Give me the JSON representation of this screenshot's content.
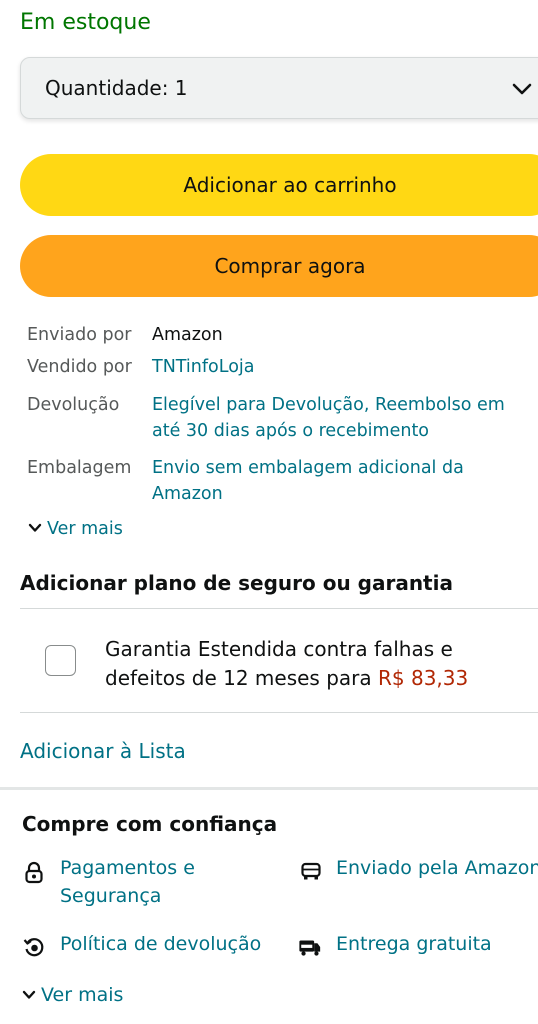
{
  "stock_status": "Em estoque",
  "quantity": {
    "label": "Quantidade: 1"
  },
  "buttons": {
    "add_to_cart": "Adicionar ao carrinho",
    "buy_now": "Comprar agora"
  },
  "details": {
    "shipped_by": {
      "label": "Enviado por",
      "value": "Amazon"
    },
    "sold_by": {
      "label": "Vendido por",
      "value": "TNTinfoLoja"
    },
    "returns": {
      "label": "Devolução",
      "line1": "Elegível para Devolução, Reembolso em",
      "line2": "até 30 dias após o recebimento"
    },
    "packaging": {
      "label": "Embalagem",
      "line1": "Envio sem embalagem adicional da",
      "line2": "Amazon"
    },
    "see_more": "Ver mais"
  },
  "protection": {
    "heading": "Adicionar plano de seguro ou garantia",
    "option_line1": "Garantia Estendida contra falhas e",
    "option_line2_prefix": "defeitos de 12 meses para",
    "option_price": "R$ 83,33"
  },
  "add_to_list": "Adicionar à Lista",
  "trust": {
    "heading": "Compre com confiança",
    "items": [
      {
        "icon": "lock-icon",
        "line1": "Pagamentos e",
        "line2": "Segurança"
      },
      {
        "icon": "truck-icon",
        "line1": "Enviado pela Amazon"
      },
      {
        "icon": "return-policy-icon",
        "line1": "Política de devolução"
      },
      {
        "icon": "free-delivery-truck-icon",
        "line1": "Entrega gratuita"
      }
    ],
    "see_more": "Ver mais"
  },
  "colors": {
    "stock_green": "#007600",
    "link_teal": "#007185",
    "cart_yellow": "#ffd814",
    "buy_orange": "#ffa41c",
    "price_red": "#b12704"
  }
}
